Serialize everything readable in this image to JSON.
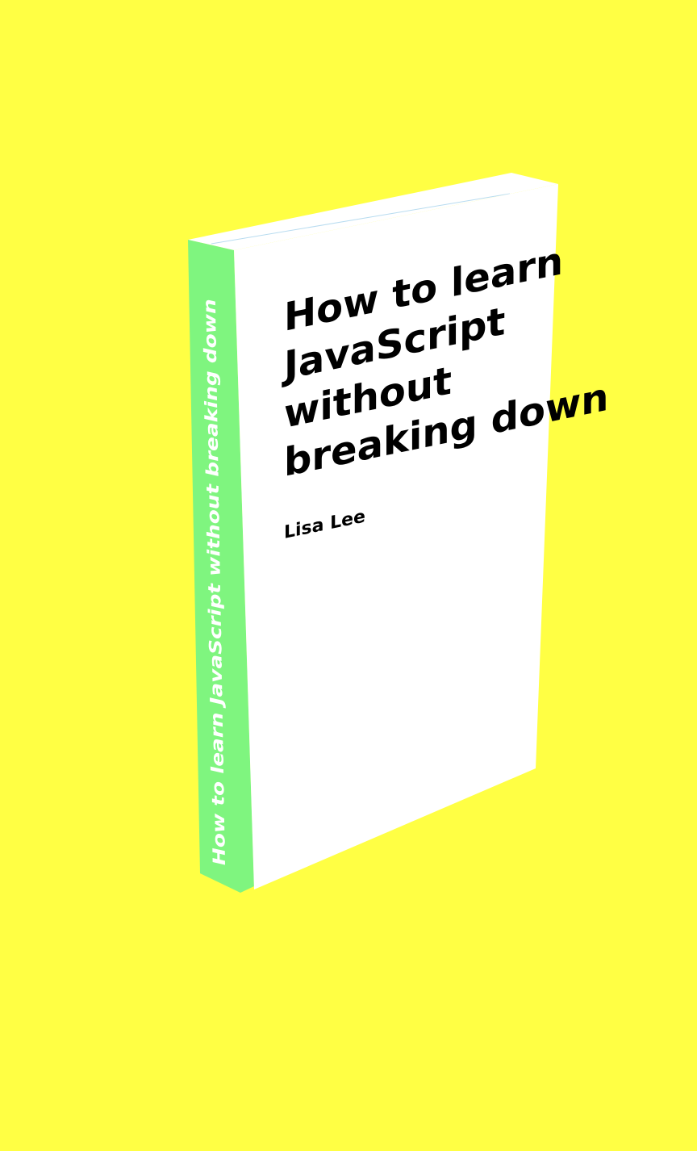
{
  "colors": {
    "background": "#ffff44",
    "spine": "#7ff57f",
    "cover": "#ffffff",
    "cover_text": "#000000",
    "spine_text": "#ffffff",
    "pages_edge": "#b8dcf0"
  },
  "book": {
    "cover": {
      "title_lines": [
        "How to learn",
        "JavaScript",
        "without",
        "breaking down"
      ],
      "author": "Lisa Lee"
    },
    "spine": {
      "title": "How to learn JavaScript without breaking down"
    }
  }
}
